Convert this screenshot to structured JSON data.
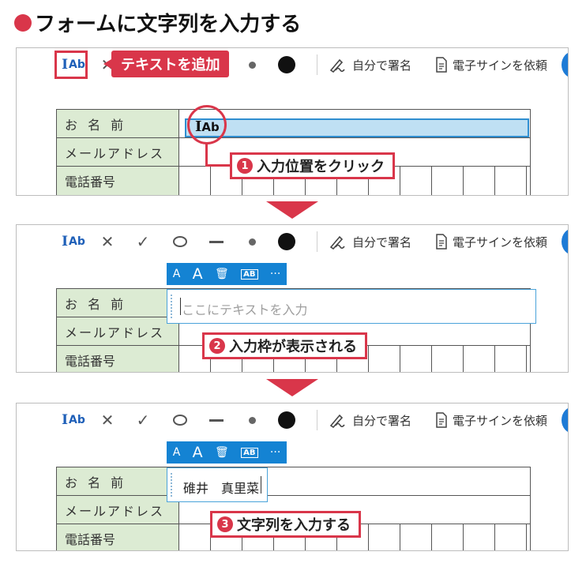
{
  "title": "フォームに文字列を入力する",
  "toolbar": {
    "text_add_label": "Ab",
    "text_add_cursor": "I",
    "x_icon": "✕",
    "check_icon": "✓",
    "sign_label": "自分で署名",
    "request_label": "電子サインを依頼"
  },
  "form": {
    "name_label": "お 名 前",
    "email_label": "メールアドレス",
    "phone_label": "電話番号"
  },
  "steps": [
    {
      "label_callout": "テキストを追加",
      "number": "1",
      "text": "入力位置をクリック"
    },
    {
      "number": "2",
      "text": "入力枠が表示される",
      "placeholder": "ここにテキストを入力"
    },
    {
      "number": "3",
      "text": "文字列を入力する",
      "typed_value": "碓井　真里菜"
    }
  ],
  "mini_toolbar": {
    "small_a": "A",
    "large_a": "A",
    "trash_icon": "🗑",
    "ab_box": "AB",
    "more": "···"
  },
  "colors": {
    "accent_red": "#d9364a",
    "brand_blue": "#1483d3",
    "label_green": "#dcebd3"
  }
}
